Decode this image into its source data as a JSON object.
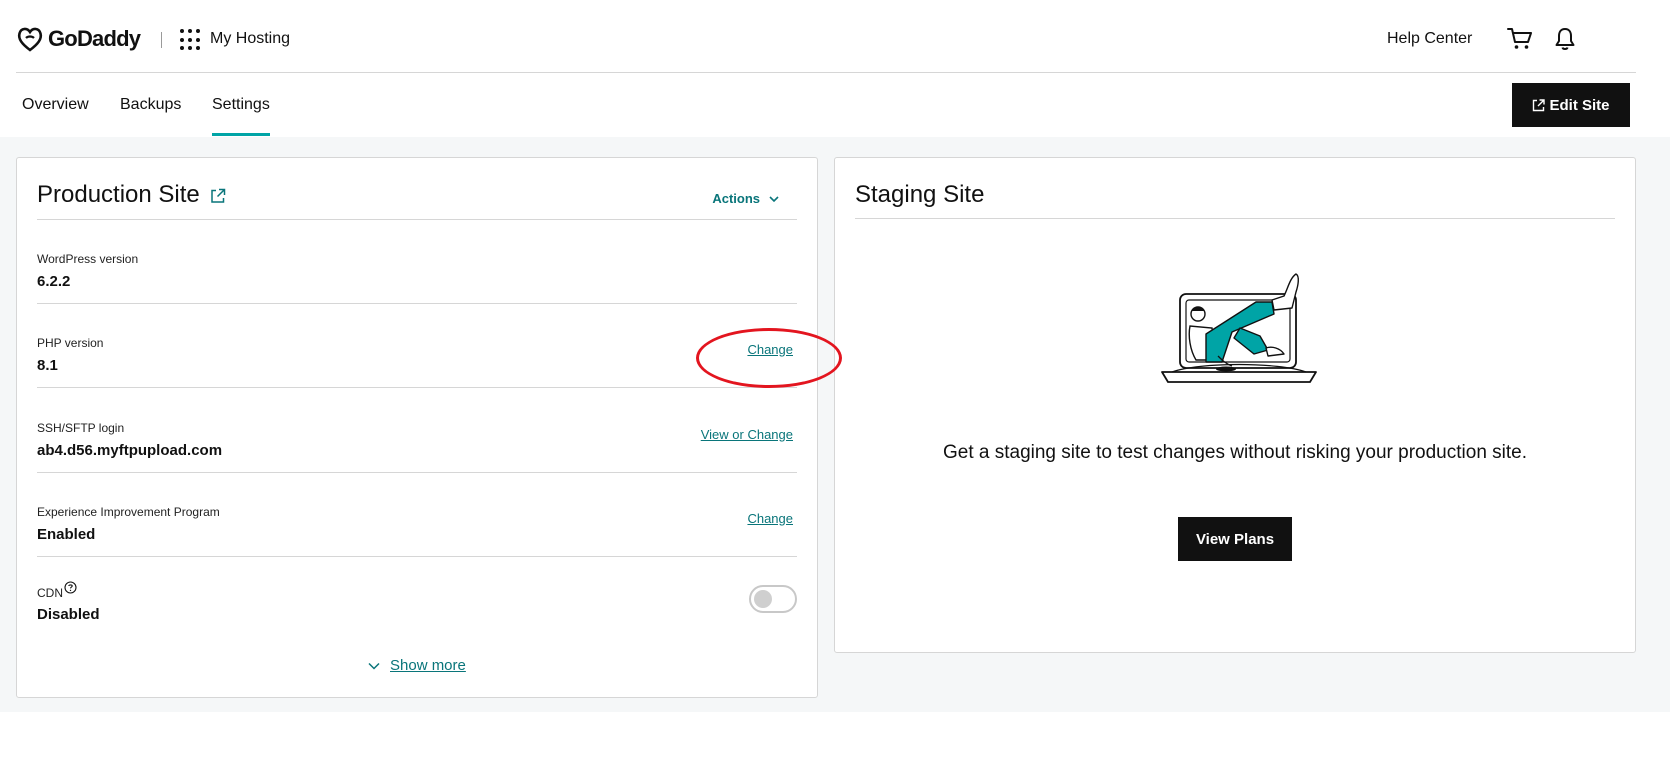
{
  "header": {
    "brand": "GoDaddy",
    "app_title": "My Hosting",
    "help_center": "Help Center",
    "icons": {
      "logo": "godaddy-logo",
      "apps": "apps-grid-icon",
      "cart": "cart-icon",
      "notifications": "bell-icon"
    }
  },
  "tabs": [
    {
      "label": "Overview",
      "active": false
    },
    {
      "label": "Backups",
      "active": false
    },
    {
      "label": "Settings",
      "active": true
    }
  ],
  "edit_site_label": "Edit Site",
  "production": {
    "title": "Production Site",
    "actions_label": "Actions",
    "rows": [
      {
        "label": "WordPress version",
        "value": "6.2.2"
      },
      {
        "label": "PHP version",
        "value": "8.1",
        "link": "Change"
      },
      {
        "label": "SSH/SFTP login",
        "value": "ab4.d56.myftpupload.com",
        "link": "View or Change"
      },
      {
        "label": "Experience Improvement Program",
        "value": "Enabled",
        "link": "Change"
      },
      {
        "label": "CDN",
        "value": "Disabled",
        "toggle_on": false
      }
    ],
    "show_more": "Show more"
  },
  "staging": {
    "title": "Staging Site",
    "description": "Get a staging site to test changes without risking your production site.",
    "button": "View Plans"
  },
  "colors": {
    "accent_teal": "#00a4a6",
    "link_teal": "#09757a",
    "button_dark": "#111111",
    "background_gray": "#f5f7f8",
    "annotation_red": "#e3151f"
  }
}
